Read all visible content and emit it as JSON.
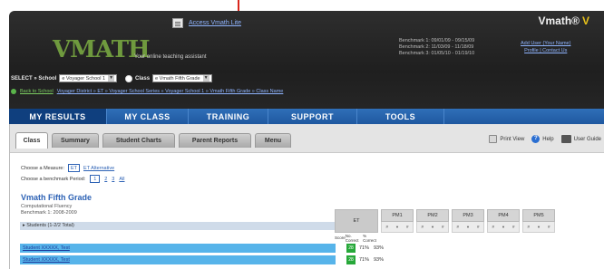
{
  "header": {
    "access_link": "Access Vmath Lite",
    "brand": "Vmath®",
    "brand_mark": "V",
    "logo_text": "VMATH",
    "tagline": "Your online teaching assistant",
    "benchmark_info": [
      "Benchmark 1: 09/01/09 - 09/15/09",
      "Benchmark 2: 11/03/09 - 11/18/09",
      "Benchmark 3: 01/05/10 - 01/19/10"
    ],
    "user_links": [
      "Add User (Your Name)",
      "Profile | Contact Us"
    ]
  },
  "select_row": {
    "school_label": "SELECT » School",
    "school_value": "e Voyager School 1",
    "class_label": "Class",
    "class_value": "e Vmath Fifth Grade"
  },
  "breadcrumb": {
    "back": "Back to School",
    "path": "Voyager District » ET » Voyager School Series » Voyager School 1 » Vmath Fifth Grade » Class Name"
  },
  "nav": {
    "items": [
      "MY RESULTS",
      "MY CLASS",
      "TRAINING",
      "SUPPORT",
      "TOOLS"
    ]
  },
  "tabs": [
    "Class",
    "Summary",
    "Student Charts",
    "Parent Reports",
    "Menu"
  ],
  "tools": {
    "print": "Print View",
    "help": "Help",
    "guide": "User Guide"
  },
  "measure": {
    "label": "Choose a Measure:",
    "chip": "ET",
    "link": "ET Alternative"
  },
  "benchmark_period": {
    "label": "Choose a benchmark Period:",
    "options": [
      "1",
      "2",
      "3",
      "All"
    ]
  },
  "class_info": {
    "title": "Vmath Fifth Grade",
    "sub1": "Computational Fluency",
    "sub2": "Benchmark 1: 2008-2009"
  },
  "students_header": "▸ Students (1-2/2 Total)",
  "bench_columns": [
    "ET",
    "PM1",
    "PM2",
    "PM3",
    "PM4",
    "PM5"
  ],
  "sub_labels": [
    "Score",
    "No. Correct",
    "% Correct"
  ],
  "students": [
    {
      "name": "Student XXXXX, Test",
      "score": "28",
      "pct1": "71%",
      "pct2": "93%"
    },
    {
      "name": "Student XXXXX, Test",
      "score": "28",
      "pct1": "71%",
      "pct2": "93%"
    }
  ],
  "colors": {
    "nav_blue": "#1f58a0",
    "active_nav": "#0f3f7e",
    "row_highlight": "#57b4ea",
    "score_green": "#27a83a",
    "logo_green": "#6f9a3e"
  }
}
